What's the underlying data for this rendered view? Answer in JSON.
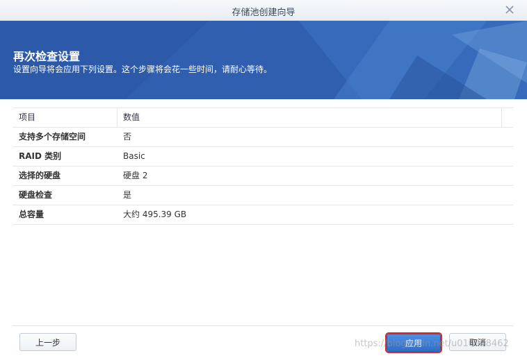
{
  "window": {
    "title": "存储池创建向导",
    "close_icon": "close-icon"
  },
  "banner": {
    "heading": "再次检查设置",
    "subtitle": "设置向导将会应用下列设置。这个步骤将会花一些时间，请耐心等待。"
  },
  "table": {
    "columns": [
      "项目",
      "数值"
    ],
    "rows": [
      {
        "key": "支持多个存储空间",
        "value": "否"
      },
      {
        "key": "RAID 类别",
        "value": "Basic"
      },
      {
        "key": "选择的硬盘",
        "value": "硬盘 2"
      },
      {
        "key": "硬盘检查",
        "value": "是"
      },
      {
        "key": "总容量",
        "value": "大约 495.39 GB"
      }
    ]
  },
  "buttons": {
    "prev": "上一步",
    "apply": "应用",
    "cancel": "取消"
  },
  "watermark": "https://blog.csdn.net/u010958462",
  "colors": {
    "banner_bg": "#2d5aa8",
    "apply_bg": "#3a7bd5",
    "highlight": "#d42d2d"
  }
}
